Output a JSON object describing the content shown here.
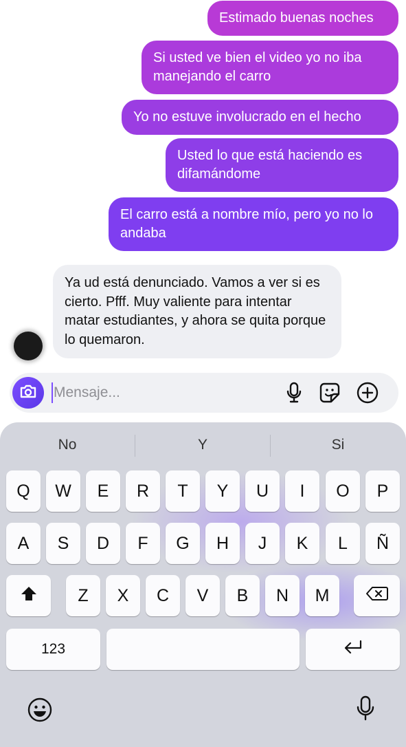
{
  "messages": {
    "outgoing": [
      "Estimado buenas noches",
      "Si usted ve bien el video yo no iba manejando el carro",
      "Yo no estuve involucrado en el hecho",
      "Usted lo que está haciendo es difamándome",
      "El carro está a nombre mío, pero yo no lo andaba"
    ],
    "incoming": [
      "Ya ud está denunciado. Vamos a ver si es cierto. Pfff. Muy valiente para intentar matar estudiantes, y ahora se quita porque lo quemaron."
    ]
  },
  "composer": {
    "placeholder": "Mensaje...",
    "icons": [
      "camera-icon",
      "microphone-icon",
      "sticker-icon",
      "add-icon"
    ]
  },
  "keyboard": {
    "suggestions": [
      "No",
      "Y",
      "Si"
    ],
    "row1": [
      "Q",
      "W",
      "E",
      "R",
      "T",
      "Y",
      "U",
      "I",
      "O",
      "P"
    ],
    "row2": [
      "A",
      "S",
      "D",
      "F",
      "G",
      "H",
      "J",
      "K",
      "L",
      "Ñ"
    ],
    "row3": [
      "Z",
      "X",
      "C",
      "V",
      "B",
      "N",
      "M"
    ],
    "numbers_label": "123",
    "icons": [
      "shift-icon",
      "backspace-icon",
      "return-icon",
      "emoji-icon",
      "dictation-icon"
    ]
  },
  "colors": {
    "outgoing_top": "#b43ad8",
    "outgoing_bottom": "#7c3cf0",
    "incoming_bg": "#eeeff3",
    "accent": "#7b4dff",
    "keyboard_bg": "#d3d5dd"
  }
}
